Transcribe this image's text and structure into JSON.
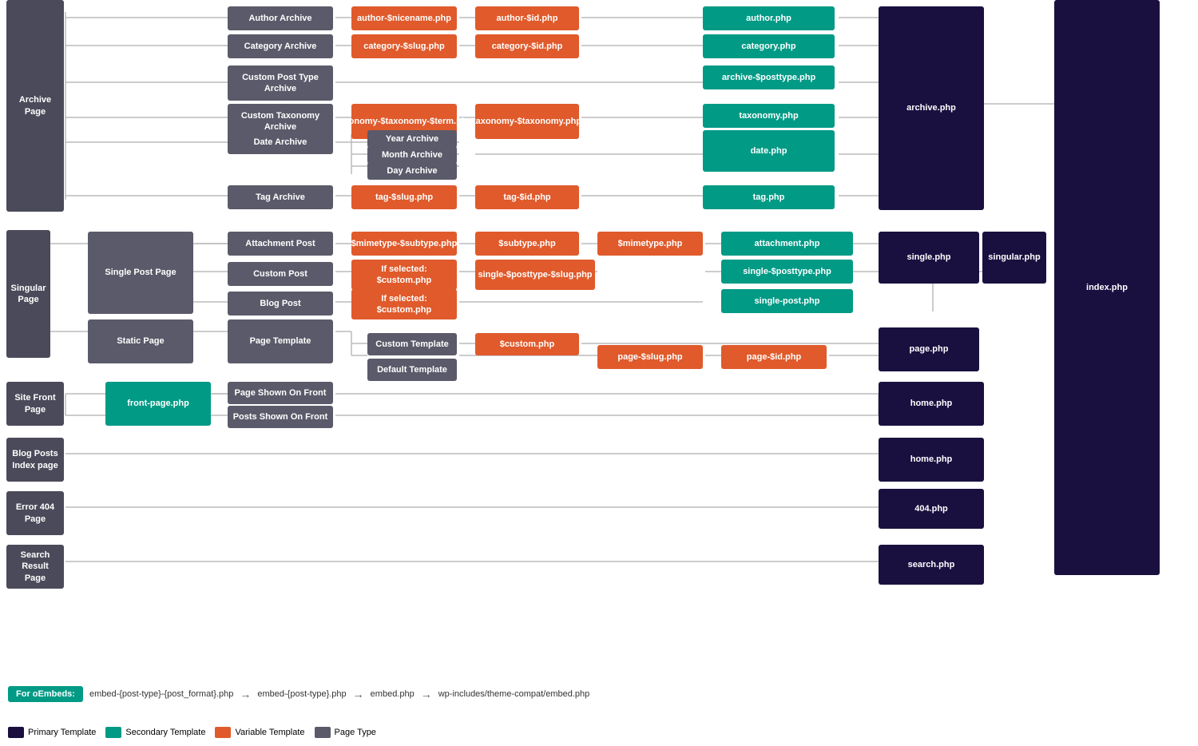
{
  "legend": {
    "items": [
      {
        "label": "Primary Template",
        "color": "#1a1040"
      },
      {
        "label": "Secondary Template",
        "color": "#009a85"
      },
      {
        "label": "Variable Template",
        "color": "#e05a2b"
      },
      {
        "label": "Page Type",
        "color": "#5a5a6a"
      }
    ]
  },
  "oembeds": {
    "label": "For oEmbeds:",
    "items": [
      "embed-{post-type}-{post_format}.php",
      "embed-{post-type}.php",
      "embed.php",
      "wp-includes/theme-compat/embed.php"
    ]
  },
  "nodes": {
    "archive_page": "Archive Page",
    "author_archive": "Author Archive",
    "category_archive": "Category Archive",
    "custom_post_type_archive": "Custom Post Type Archive",
    "custom_taxonomy_archive": "Custom Taxonomy Archive",
    "date_archive": "Date Archive",
    "year_archive": "Year Archive",
    "month_archive": "Month Archive",
    "day_archive": "Day Archive",
    "tag_archive": "Tag Archive",
    "author_nicename": "author-$nicename.php",
    "author_id": "author-$id.php",
    "author_php": "author.php",
    "category_slug": "category-$slug.php",
    "category_id": "category-$id.php",
    "category_php": "category.php",
    "archive_posttype": "archive-$posttype.php",
    "taxonomy_term": "taxonomy-$taxonomy-$term.php",
    "taxonomy_tax": "taxonomy-$taxonomy.php",
    "taxonomy_php": "taxonomy.php",
    "date_php": "date.php",
    "tag_slug": "tag-$slug.php",
    "tag_id": "tag-$id.php",
    "tag_php": "tag.php",
    "archive_php": "archive.php",
    "index_php": "index.php",
    "singular_page": "Singular Page",
    "single_post_page": "Single Post Page",
    "attachment_post": "Attachment Post",
    "custom_post": "Custom Post",
    "blog_post": "Blog Post",
    "static_page": "Static Page",
    "page_template": "Page Template",
    "custom_template": "Custom Template",
    "default_template": "Default Template",
    "mimetype_subtype": "$mimetype-$subtype.php",
    "subtype_php": "$subtype.php",
    "mimetype_php": "$mimetype.php",
    "attachment_php": "attachment.php",
    "if_selected_custom1": "If selected: $custom.php",
    "single_posttype_slug": "single-$posttype-$slug.php",
    "single_posttype": "single-$posttype.php",
    "if_selected_custom2": "If selected: $custom.php",
    "single_post_php": "single-post.php",
    "custom_php": "$custom.php",
    "page_slug": "page-$slug.php",
    "page_id": "page-$id.php",
    "single_php": "single.php",
    "singular_php": "singular.php",
    "page_php": "page.php",
    "site_front_page": "Site Front Page",
    "front_page_php": "front-page.php",
    "page_shown_on_front": "Page Shown On Front",
    "posts_shown_on_front": "Posts Shown On Front",
    "home_php": "home.php",
    "blog_posts_index": "Blog Posts Index page",
    "error_404": "Error 404 Page",
    "error_404_php": "404.php",
    "search_result": "Search Result Page",
    "search_php": "search.php",
    "secondary_template": "Secondary Template"
  }
}
